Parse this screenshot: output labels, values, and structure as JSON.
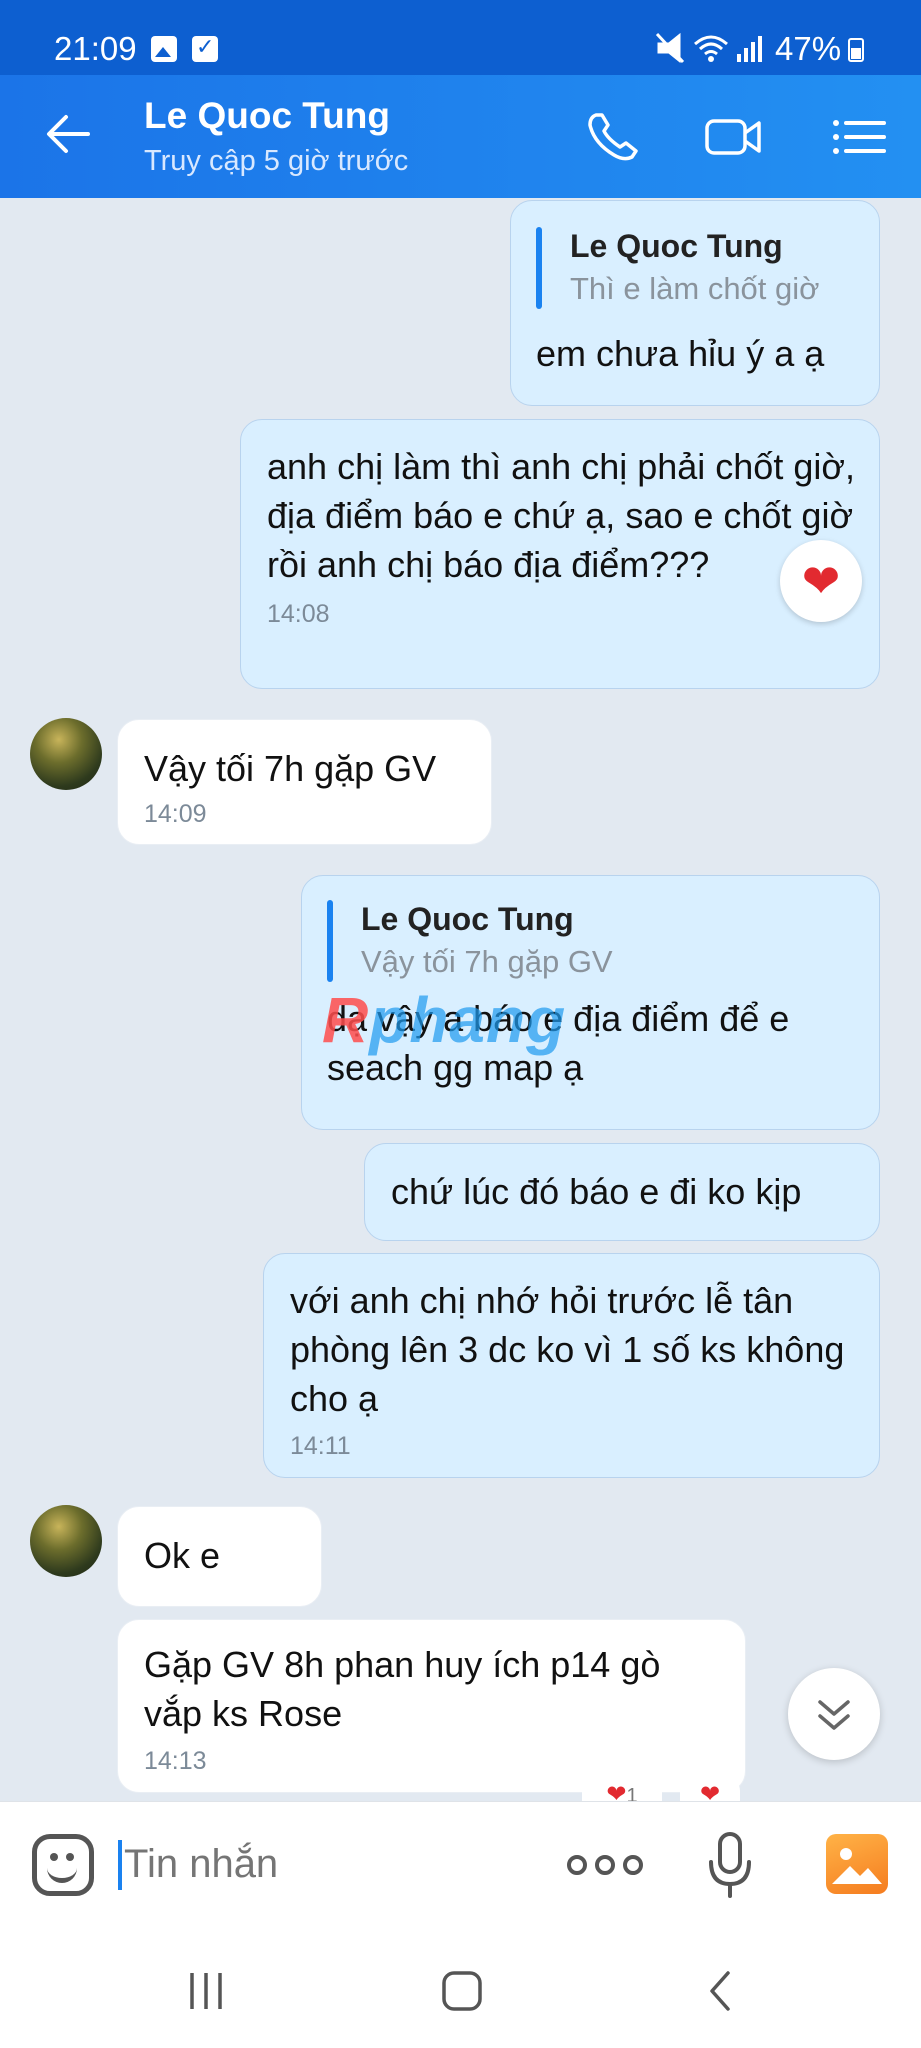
{
  "status_bar": {
    "time": "21:09",
    "battery": "47%"
  },
  "header": {
    "title": "Le Quoc Tung",
    "subtitle": "Truy cập 5 giờ trước"
  },
  "messages": [
    {
      "direction": "out",
      "quote_name": "Le Quoc Tung",
      "quote_text": "Thì e làm chốt giờ",
      "text": "em chưa hỉu ý a ạ"
    },
    {
      "direction": "out",
      "text": "anh chị làm thì anh chị phải chốt giờ, địa điểm báo e chứ ạ, sao e chốt giờ rồi anh chị báo địa điểm???",
      "time": "14:08",
      "reaction": "❤"
    },
    {
      "direction": "in",
      "text": "Vậy tối 7h gặp GV",
      "time": "14:09"
    },
    {
      "direction": "out",
      "quote_name": "Le Quoc Tung",
      "quote_text": "Vậy tối 7h gặp GV",
      "text": "dạ vậy a báo e địa điểm để e seach gg map ạ"
    },
    {
      "direction": "out",
      "text": "chứ lúc đó báo e đi ko kịp"
    },
    {
      "direction": "out",
      "text": "với anh chị nhớ hỏi trước lễ tân phòng lên 3 dc ko vì 1 số ks không cho ạ",
      "time": "14:11"
    },
    {
      "direction": "in",
      "text": "Ok e"
    },
    {
      "direction": "in",
      "text": "Gặp GV 8h phan huy ích p14 gò vắp ks Rose",
      "time": "14:13"
    }
  ],
  "watermark": {
    "first": "R",
    "rest": "phang"
  },
  "reactions_partial": {
    "count": "1"
  },
  "composer": {
    "placeholder": "Tin nhắn"
  },
  "colors": {
    "accent": "#1a82f0",
    "header": "#1b74e8",
    "bubble_out": "#d9efff",
    "bubble_in": "#ffffff",
    "background": "#e2e9f1"
  }
}
